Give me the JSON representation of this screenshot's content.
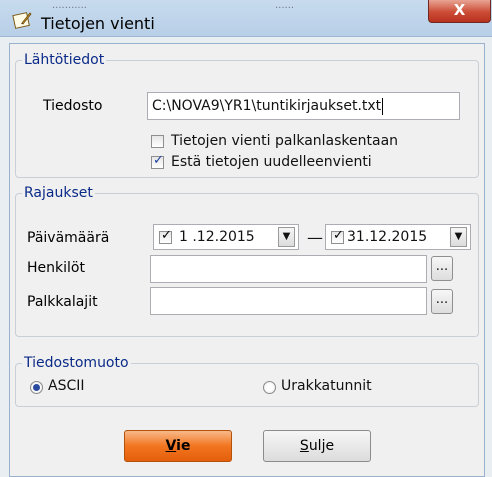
{
  "window": {
    "title": "Tietojen vienti",
    "close_label": "X",
    "ghost_text_1": "...........",
    "ghost_text_2": "......"
  },
  "lahtotiedot": {
    "legend": "Lähtötiedot",
    "file_label": "Tiedosto",
    "file_value": "C:\\NOVA9\\YR1\\tuntikirjaukset.txt",
    "checkbox_palkanlaskenta": {
      "label": "Tietojen vienti palkanlaskentaan",
      "checked": false
    },
    "checkbox_uudelleenvienti": {
      "label": "Estä tietojen uudelleenvienti",
      "checked": true
    }
  },
  "rajaukset": {
    "legend": "Rajaukset",
    "date_label": "Päivämäärä",
    "date_from": "1 .12.2015",
    "date_to": "31.12.2015",
    "date_separator": "—",
    "persons_label": "Henkilöt",
    "persons_value": "",
    "paytypes_label": "Palkkalajit",
    "paytypes_value": "",
    "browse_label": "..."
  },
  "tiedostomuoto": {
    "legend": "Tiedostomuoto",
    "option_ascii": "ASCII",
    "option_urakka": "Urakkatunnit",
    "selected": "ASCII"
  },
  "buttons": {
    "vie_mnemonic": "V",
    "vie_rest": "ie",
    "sulje_mnemonic": "S",
    "sulje_rest": "ulje"
  },
  "colors": {
    "accent_orange": "#f2751f",
    "legend_blue": "#0a2a88",
    "close_red": "#cc4c36"
  },
  "icons": {
    "app": "paper-pen-icon",
    "dropdown": "chevron-down-icon",
    "check": "checkmark-icon"
  }
}
